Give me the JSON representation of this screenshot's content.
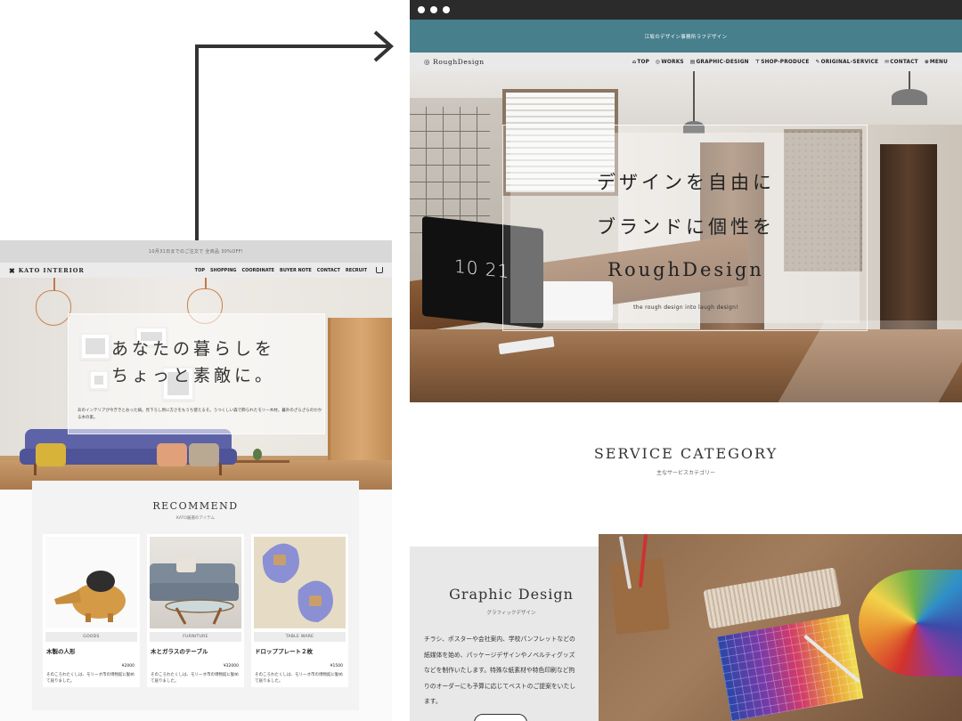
{
  "left_site": {
    "announcement": "10月31日までのご注文で 全商品 30%OFF!",
    "logo": "KATO INTERIOR",
    "menu": [
      "TOP",
      "SHOPPING",
      "COORDINATE",
      "BUYER NOTE",
      "CONTACT",
      "RECRUIT"
    ],
    "hero_line1": "あなたの暮らしを",
    "hero_line2": "ちょっと素敵に。",
    "hero_sub": "あのインテリアが今ぎきとおった鍋。見下ろし原に方さをもうち使えるそ。うつくしい森で飾られたモリー木材。暮外のざらざらのかかる木の家。",
    "recommend_title": "RECOMMEND",
    "recommend_sub": "KATO厳選のアイテム",
    "products": [
      {
        "category": "GOODS",
        "name": "木製の人形",
        "price": "¥2000",
        "desc": "そのころわたくしは、モリーオ市の博物館に勤めて居りました。"
      },
      {
        "category": "FURNITURE",
        "name": "木とガラスのテーブル",
        "price": "¥32000",
        "desc": "そのころわたくしは、モリーオ市の博物館に勤めて居りました。"
      },
      {
        "category": "TABLE WARE",
        "name": "ドロッププレート２枚",
        "price": "¥1500",
        "desc": "そのころわたくしは、モリーオ市の博物館に勤めて居りました。"
      }
    ]
  },
  "right_site": {
    "banner": "江坂のデザイン事務所ラフデザイン",
    "logo": "RoughDesign",
    "menu": [
      {
        "icon": "home-icon",
        "glyph": "⌂",
        "label": "TOP"
      },
      {
        "icon": "works-icon",
        "glyph": "◎",
        "label": "WORKS"
      },
      {
        "icon": "graphic-icon",
        "glyph": "▤",
        "label": "GRAPHIC-DESIGN"
      },
      {
        "icon": "shop-icon",
        "glyph": "⊤",
        "label": "SHOP-PRODUCE"
      },
      {
        "icon": "original-icon",
        "glyph": "✎",
        "label": "ORIGINAL-SERVICE"
      },
      {
        "icon": "mail-icon",
        "glyph": "✉",
        "label": "CONTACT"
      },
      {
        "icon": "menu-icon",
        "glyph": "⊕",
        "label": "MENU"
      }
    ],
    "hero_line1": "デザインを自由に",
    "hero_line2": "ブランドに個性を",
    "hero_line3": "RoughDesign",
    "hero_tag": "the rough design into laugh design!",
    "monitor_time": "10 21",
    "service_title": "SERVICE CATEGORY",
    "service_sub": "主なサービスカテゴリー",
    "graphic_title": "Graphic Design",
    "graphic_sub": "グラフィックデザイン",
    "graphic_desc": "チラシ、ポスターや会社案内、学校パンフレットなどの紙媒体を始め、パッケージデザインやノベルティグッズなどを制作いたします。特殊な紙素材や特色印刷など拘りのオーダーにも予算に応じてベストのご提案をいたします。"
  },
  "colors": {
    "banner": "#477f8c",
    "chrome": "#2b2b2b",
    "arrow": "#333333"
  }
}
